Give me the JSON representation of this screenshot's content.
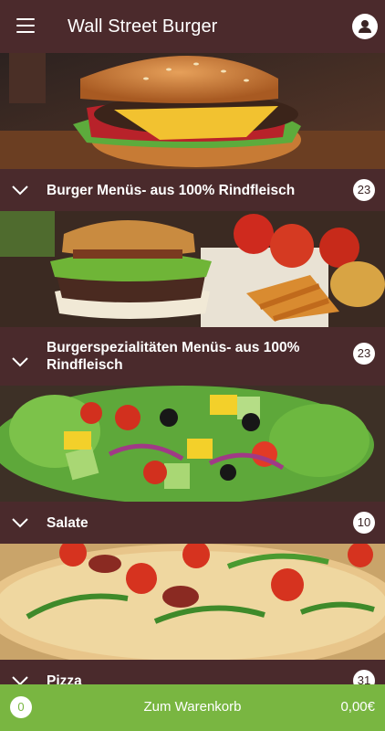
{
  "header": {
    "title": "Wall Street Burger",
    "menu_icon": "hamburger-menu-icon",
    "account_icon": "user-account-icon"
  },
  "categories": [
    {
      "name": "Burger Menüs- aus 100% Rindfleisch",
      "count": "23",
      "image": "burger-photo"
    },
    {
      "name": "Burgerspezialitäten Menüs- aus 100% Rindfleisch",
      "count": "23",
      "image": "burger-fries-photo"
    },
    {
      "name": "Salate",
      "count": "10",
      "image": "salad-photo"
    },
    {
      "name": "Pizza",
      "count": "31",
      "image": "pizza-photo"
    }
  ],
  "cart": {
    "count": "0",
    "label": "Zum Warenkorb",
    "total": "0,00€"
  },
  "colors": {
    "header_bg": "#4b2a2c",
    "category_bar_bg": "#4a2a2c",
    "cart_bar_bg": "#79b641"
  }
}
